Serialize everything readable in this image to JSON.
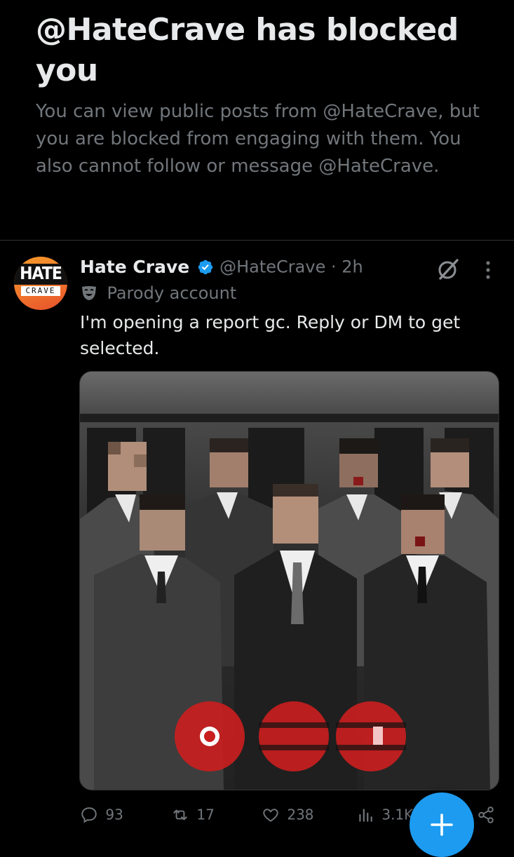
{
  "blocked_notice": {
    "title": "@HateCrave has blocked you",
    "description": "You can view public posts from @HateCrave, but you are blocked from engaging with them. You also cannot follow or message @HateCrave."
  },
  "tweet": {
    "avatar_top": "HATE",
    "avatar_bottom": "CRAVE",
    "display_name": "Hate Crave",
    "handle_time": "@HateCrave · 2h",
    "parody_label": "Parody account",
    "text": "I'm opening a report gc. Reply or DM to get selected.",
    "actions": {
      "replies": "93",
      "reposts": "17",
      "likes": "238",
      "views": "3.1K"
    }
  },
  "colors": {
    "background": "#000000",
    "primary_text": "#e7e9ea",
    "secondary_text": "#71767b",
    "verified": "#1d9bf0",
    "fab": "#1d9bf0"
  },
  "icons": [
    "verified-badge-icon",
    "grok-icon",
    "more-icon",
    "parody-mask-icon",
    "reply-icon",
    "repost-icon",
    "like-icon",
    "views-icon",
    "share-icon",
    "plus-icon"
  ]
}
